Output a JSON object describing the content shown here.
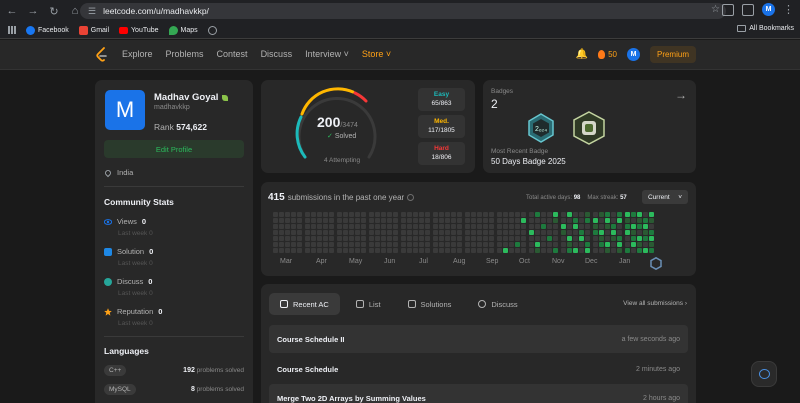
{
  "browser": {
    "url": "leetcode.com/u/madhavkkp/",
    "avatar_initial": "M",
    "bookmarks": [
      {
        "label": "Facebook",
        "color": "#1877f2"
      },
      {
        "label": "Gmail",
        "color": "#ea4335"
      },
      {
        "label": "YouTube",
        "color": "#ff0000"
      },
      {
        "label": "Maps",
        "color": "#34a853"
      }
    ],
    "all_bookmarks": "All Bookmarks"
  },
  "nav": {
    "links": [
      "Explore",
      "Problems",
      "Contest",
      "Discuss",
      "Interview ˅",
      "Store ˅"
    ],
    "streak": "50",
    "avatar_initial": "M",
    "premium": "Premium"
  },
  "profile": {
    "avatar_initial": "M",
    "name": "Madhav Goyal",
    "username": "madhavkkp",
    "rank_label": "Rank",
    "rank": "574,622",
    "edit_button": "Edit Profile",
    "location": "India",
    "community_title": "Community Stats",
    "stats": [
      {
        "label": "Views",
        "value": "0",
        "sub": "Last week",
        "sub_value": "0",
        "color": "#1a73e8"
      },
      {
        "label": "Solution",
        "value": "0",
        "sub": "Last week",
        "sub_value": "0",
        "color": "#1e88e5"
      },
      {
        "label": "Discuss",
        "value": "0",
        "sub": "Last week",
        "sub_value": "0",
        "color": "#26a69a"
      },
      {
        "label": "Reputation",
        "value": "0",
        "sub": "Last week",
        "sub_value": "0",
        "color": "#ffa116"
      }
    ],
    "languages_title": "Languages",
    "languages": [
      {
        "name": "C++",
        "count": "192",
        "suffix": "problems solved"
      },
      {
        "name": "MySQL",
        "count": "8",
        "suffix": "problems solved"
      }
    ]
  },
  "solved": {
    "count": "200",
    "total": "/3474",
    "label": "Solved",
    "attempting": "4 Attempting",
    "easy": {
      "label": "Easy",
      "value": "65/863",
      "color": "#1cbaba"
    },
    "medium": {
      "label": "Med.",
      "value": "117/1805",
      "color": "#ffb700"
    },
    "hard": {
      "label": "Hard",
      "value": "18/806",
      "color": "#f63737"
    }
  },
  "badges": {
    "label": "Badges",
    "count": "2",
    "recent_label": "Most Recent Badge",
    "recent": "50 Days Badge 2025",
    "badge1_text": "2ₒ₂₄"
  },
  "calendar": {
    "count": "415",
    "text": "submissions in the past one year",
    "active_label": "Total active days:",
    "active_days": "98",
    "streak_label": "Max streak:",
    "max_streak": "57",
    "select": "Current",
    "months": [
      "Mar",
      "Apr",
      "May",
      "Jun",
      "Jul",
      "Aug",
      "Sep",
      "Oct",
      "Nov",
      "Dec",
      "Jan"
    ]
  },
  "submissions": {
    "tabs": [
      "Recent AC",
      "List",
      "Solutions",
      "Discuss"
    ],
    "view_all": "View all submissions ›",
    "rows": [
      {
        "title": "Course Schedule II",
        "time": "a few seconds ago"
      },
      {
        "title": "Course Schedule",
        "time": "2 minutes ago"
      },
      {
        "title": "Merge Two 2D Arrays by Summing Values",
        "time": "2 hours ago"
      }
    ]
  }
}
